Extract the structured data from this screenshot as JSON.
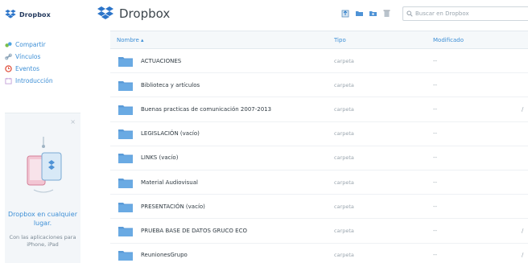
{
  "sidebar": {
    "brand": "Dropbox",
    "items": [
      {
        "label": "Compartir",
        "icon": "share-icon"
      },
      {
        "label": "Vínculos",
        "icon": "link-icon"
      },
      {
        "label": "Eventos",
        "icon": "events-icon"
      },
      {
        "label": "Introducción",
        "icon": "intro-icon"
      }
    ],
    "promo": {
      "close": "×",
      "title": "Dropbox en cualquier lugar.",
      "body": "Con las aplicaciones para iPhone, iPad"
    }
  },
  "header": {
    "title": "Dropbox",
    "search_placeholder": "Buscar en Dropbox"
  },
  "table": {
    "columns": {
      "name": "Nombre ▴",
      "type": "Tipo",
      "modified": "Modificado"
    },
    "rows": [
      {
        "name": "ACTUACIONES",
        "type": "carpeta",
        "modified": "--",
        "end": ""
      },
      {
        "name": "Biblioteca y artículos",
        "type": "carpeta",
        "modified": "--",
        "end": ""
      },
      {
        "name": "Buenas practicas de comunicación 2007-2013",
        "type": "carpeta",
        "modified": "--",
        "end": "/"
      },
      {
        "name": "LEGISLACIÓN (vacío)",
        "type": "carpeta",
        "modified": "--",
        "end": ""
      },
      {
        "name": "LINKS (vacío)",
        "type": "carpeta",
        "modified": "--",
        "end": ""
      },
      {
        "name": "Material Audiovisual",
        "type": "carpeta",
        "modified": "--",
        "end": ""
      },
      {
        "name": "PRESENTACIÓN (vacío)",
        "type": "carpeta",
        "modified": "--",
        "end": ""
      },
      {
        "name": "PRUEBA BASE DE DATOS GRUCO ECO",
        "type": "carpeta",
        "modified": "--",
        "end": "/"
      },
      {
        "name": "ReunionesGrupo",
        "type": "carpeta",
        "modified": "--",
        "end": "/"
      }
    ]
  },
  "colors": {
    "accent": "#3d8fd6",
    "folder": "#5a9bd8",
    "header_bg": "#f5f8fa"
  }
}
